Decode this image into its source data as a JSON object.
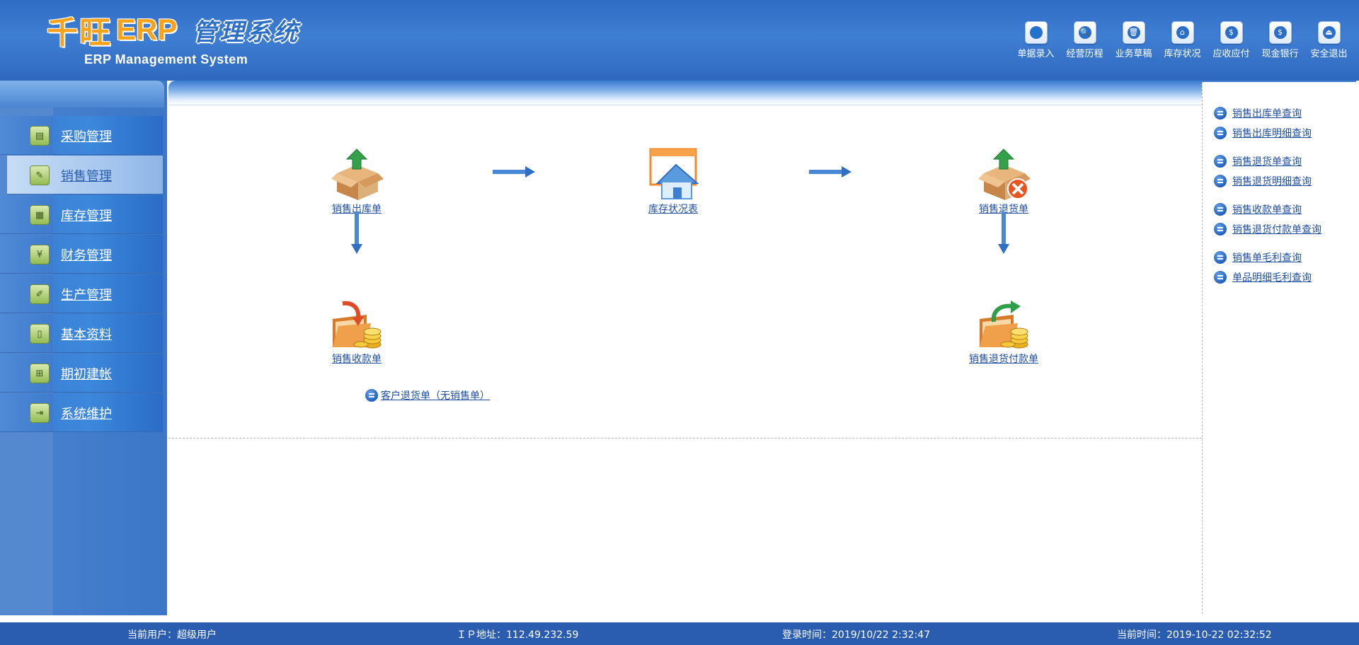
{
  "header": {
    "logo_chars": [
      "千",
      "旺"
    ],
    "logo_erp": "ERP",
    "logo_system": "管理系统",
    "logo_subtitle": "ERP Management System",
    "nav": [
      {
        "label": "单据录入",
        "icon": "user-icon",
        "glyph": "👤"
      },
      {
        "label": "经营历程",
        "icon": "search-icon",
        "glyph": "🔍"
      },
      {
        "label": "业务草稿",
        "icon": "trash-icon",
        "glyph": "🗑"
      },
      {
        "label": "库存状况",
        "icon": "home-icon",
        "glyph": "⌂"
      },
      {
        "label": "应收应付",
        "icon": "medal-icon",
        "glyph": "$"
      },
      {
        "label": "现金银行",
        "icon": "dollar-icon",
        "glyph": "$"
      },
      {
        "label": "安全退出",
        "icon": "exit-icon",
        "glyph": "⏏"
      }
    ]
  },
  "sidebar": {
    "items": [
      {
        "label": "采购管理",
        "icon": "purchase-icon",
        "glyph": "▤",
        "active": false
      },
      {
        "label": "销售管理",
        "icon": "sales-icon",
        "glyph": "✎",
        "active": true
      },
      {
        "label": "库存管理",
        "icon": "inventory-icon",
        "glyph": "▦",
        "active": false
      },
      {
        "label": "财务管理",
        "icon": "finance-icon",
        "glyph": "¥",
        "active": false
      },
      {
        "label": "生产管理",
        "icon": "production-icon",
        "glyph": "✐",
        "active": false
      },
      {
        "label": "基本资料",
        "icon": "basic-data-icon",
        "glyph": "▯",
        "active": false
      },
      {
        "label": "期初建帐",
        "icon": "opening-account-icon",
        "glyph": "⊞",
        "active": false
      },
      {
        "label": "系统维护",
        "icon": "maintenance-icon",
        "glyph": "⇥",
        "active": false
      }
    ]
  },
  "flow": {
    "sales_outbound": "销售出库单",
    "inventory_status": "库存状况表",
    "sales_return": "销售退货单",
    "sales_receipt": "销售收款单",
    "sales_return_payment": "销售退货付款单",
    "customer_return": "客户退货单（无销售单）"
  },
  "right_panel": {
    "groups": [
      [
        "销售出库单查询",
        "销售出库明细查询"
      ],
      [
        "销售退货单查询",
        "销售退货明细查询"
      ],
      [
        "销售收款单查询",
        "销售退货付款单查询"
      ],
      [
        "销售单毛利查询",
        "单品明细毛利查询"
      ]
    ]
  },
  "footer": {
    "user": "当前用户：超级用户",
    "ip": "ＩＰ地址：112.49.232.59",
    "login_time": "登录时间：2019/10/22 2:32:47",
    "current_time": "当前时间：2019-10-22 02:32:52"
  },
  "colors": {
    "header_blue": "#3f7fd3",
    "logo_orange": "#f7a21b",
    "link_blue": "#1f4fa2",
    "footer_blue": "#2a5cb0"
  }
}
